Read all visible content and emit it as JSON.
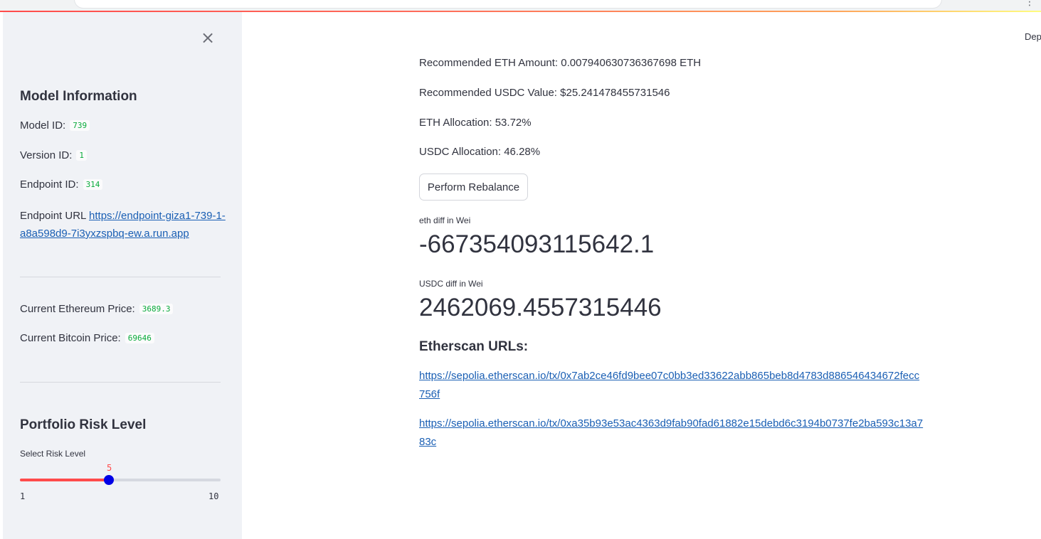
{
  "browser": {
    "right_glyphs": [
      "⋮"
    ]
  },
  "header": {
    "deploy_label": "Dep"
  },
  "sidebar": {
    "close_glyph": "×",
    "model_info": {
      "heading": "Model Information",
      "model_id_label": "Model ID:",
      "model_id": "739",
      "version_id_label": "Version ID:",
      "version_id": "1",
      "endpoint_id_label": "Endpoint ID:",
      "endpoint_id": "314",
      "endpoint_url_label": "Endpoint URL",
      "endpoint_url": "https://endpoint-giza1-739-1-a8a598d9-7i3yxzspbq-ew.a.run.app"
    },
    "prices": {
      "eth_label": "Current Ethereum Price:",
      "eth_value": "3689.3",
      "btc_label": "Current Bitcoin Price:",
      "btc_value": "69646"
    },
    "risk": {
      "heading": "Portfolio Risk Level",
      "slider_label": "Select Risk Level",
      "value": "5",
      "min": "1",
      "max": "10",
      "accent_color": "#ff4b4b",
      "thumb_color": "#0000e6"
    }
  },
  "main": {
    "eth_amount": "Recommended ETH Amount: 0.007940630736367698 ETH",
    "usdc_value": "Recommended USDC Value: $25.241478455731546",
    "eth_alloc": "ETH Allocation: 53.72%",
    "usdc_alloc": "USDC Allocation: 46.28%",
    "rebalance_button": "Perform Rebalance",
    "eth_diff_label": "eth diff in Wei",
    "eth_diff_value": "-667354093115642.1",
    "usdc_diff_label": "USDC diff in Wei",
    "usdc_diff_value": "2462069.4557315446",
    "etherscan_heading": "Etherscan URLs:",
    "tx_urls": [
      "https://sepolia.etherscan.io/tx/0x7ab2ce46fd9bee07c0bb3ed33622abb865beb8d4783d886546434672fecc756f",
      "https://sepolia.etherscan.io/tx/0xa35b93e53ac4363d9fab90fad61882e15debd6c3194b0737fe2ba593c13a783c"
    ],
    "link_color": "#1a5fb4"
  }
}
